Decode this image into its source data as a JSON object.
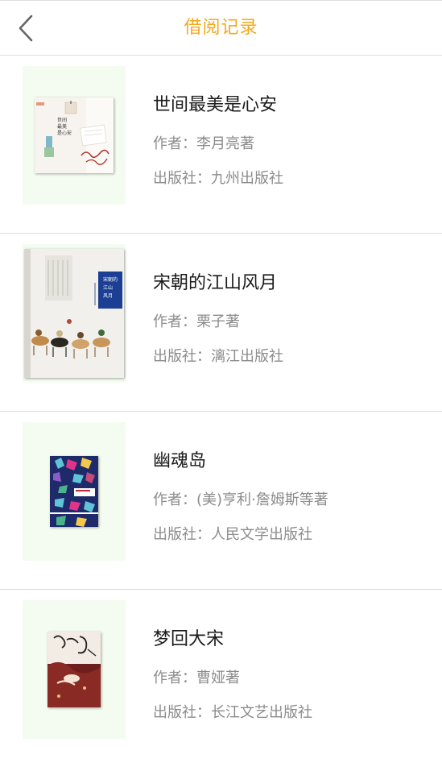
{
  "header": {
    "title": "借阅记录",
    "accent_color": "#f5a81c",
    "back_icon": "chevron-left-icon"
  },
  "books": [
    {
      "title": "世间最美是心安",
      "author_label": "作者：",
      "author": "李月亮著",
      "publisher_label": "出版社：",
      "publisher": "九州出版社"
    },
    {
      "title": "宋朝的江山风月",
      "author_label": "作者：",
      "author": "栗子著",
      "publisher_label": "出版社：",
      "publisher": "漓江出版社"
    },
    {
      "title": "幽魂岛",
      "author_label": "作者：",
      "author": "(美)亨利·詹姆斯等著",
      "publisher_label": "出版社：",
      "publisher": "人民文学出版社"
    },
    {
      "title": "梦回大宋",
      "author_label": "作者：",
      "author": "曹娅著",
      "publisher_label": "出版社：",
      "publisher": "长江文艺出版社"
    }
  ]
}
